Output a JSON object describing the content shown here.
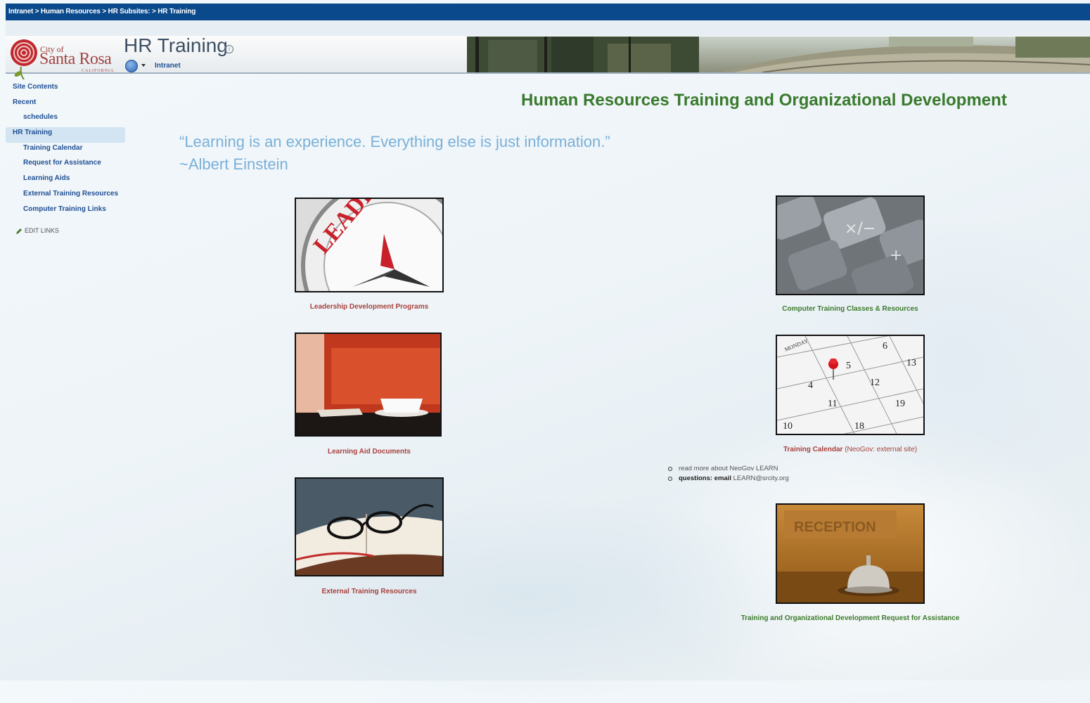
{
  "breadcrumb": {
    "items": [
      "Intranet",
      "Human Resources",
      "HR Subsites:",
      "HR Training"
    ],
    "separator": ">"
  },
  "logo": {
    "city_of": "City of",
    "name": "Santa Rosa",
    "state": "CALIFORNIA"
  },
  "header": {
    "title": "HR Training",
    "site_link": "Intranet"
  },
  "nav": {
    "items": [
      {
        "label": "Site Contents"
      },
      {
        "label": "Recent"
      },
      {
        "label": "schedules"
      },
      {
        "label": "HR Training"
      },
      {
        "label": "Training Calendar"
      },
      {
        "label": "Request for Assistance"
      },
      {
        "label": "Learning Aids"
      },
      {
        "label": "External Training Resources"
      },
      {
        "label": "Computer Training Links"
      }
    ],
    "edit_links": "EDIT LINKS"
  },
  "main": {
    "heading": "Human Resources Training and Organizational Development",
    "quote_line1": "“Learning is an experience. Everything else is just information.”",
    "quote_line2": "~Albert Einstein",
    "tiles": {
      "leadership": {
        "caption": "Leadership Development Programs",
        "image_text": "LEADERSHIP"
      },
      "computer": {
        "caption": "Computer Training Classes & Resources"
      },
      "learning_aid": {
        "caption": "Learning Aid Documents"
      },
      "calendar": {
        "caption": "Training Calendar",
        "caption_note": "(NeoGov: external site)",
        "day_label": "MONDAY",
        "dates": [
          "6",
          "13",
          "5",
          "12",
          "4",
          "11",
          "19",
          "10",
          "18"
        ]
      },
      "external": {
        "caption": "External Training Resources"
      },
      "request": {
        "caption": "Training and Organizational Development Request for Assistance",
        "image_text": "RECEPTION"
      }
    },
    "bullets": {
      "item1": "read more about NeoGov LEARN",
      "item2_label": "questions: email",
      "item2_email": "LEARN@srcity.org"
    }
  },
  "colors": {
    "topbar": "#0a4a8c",
    "link": "#1f4f92",
    "heading_green": "#3a7a2d",
    "quote_blue": "#7ab0d8",
    "caption_red": "#a8413c"
  }
}
